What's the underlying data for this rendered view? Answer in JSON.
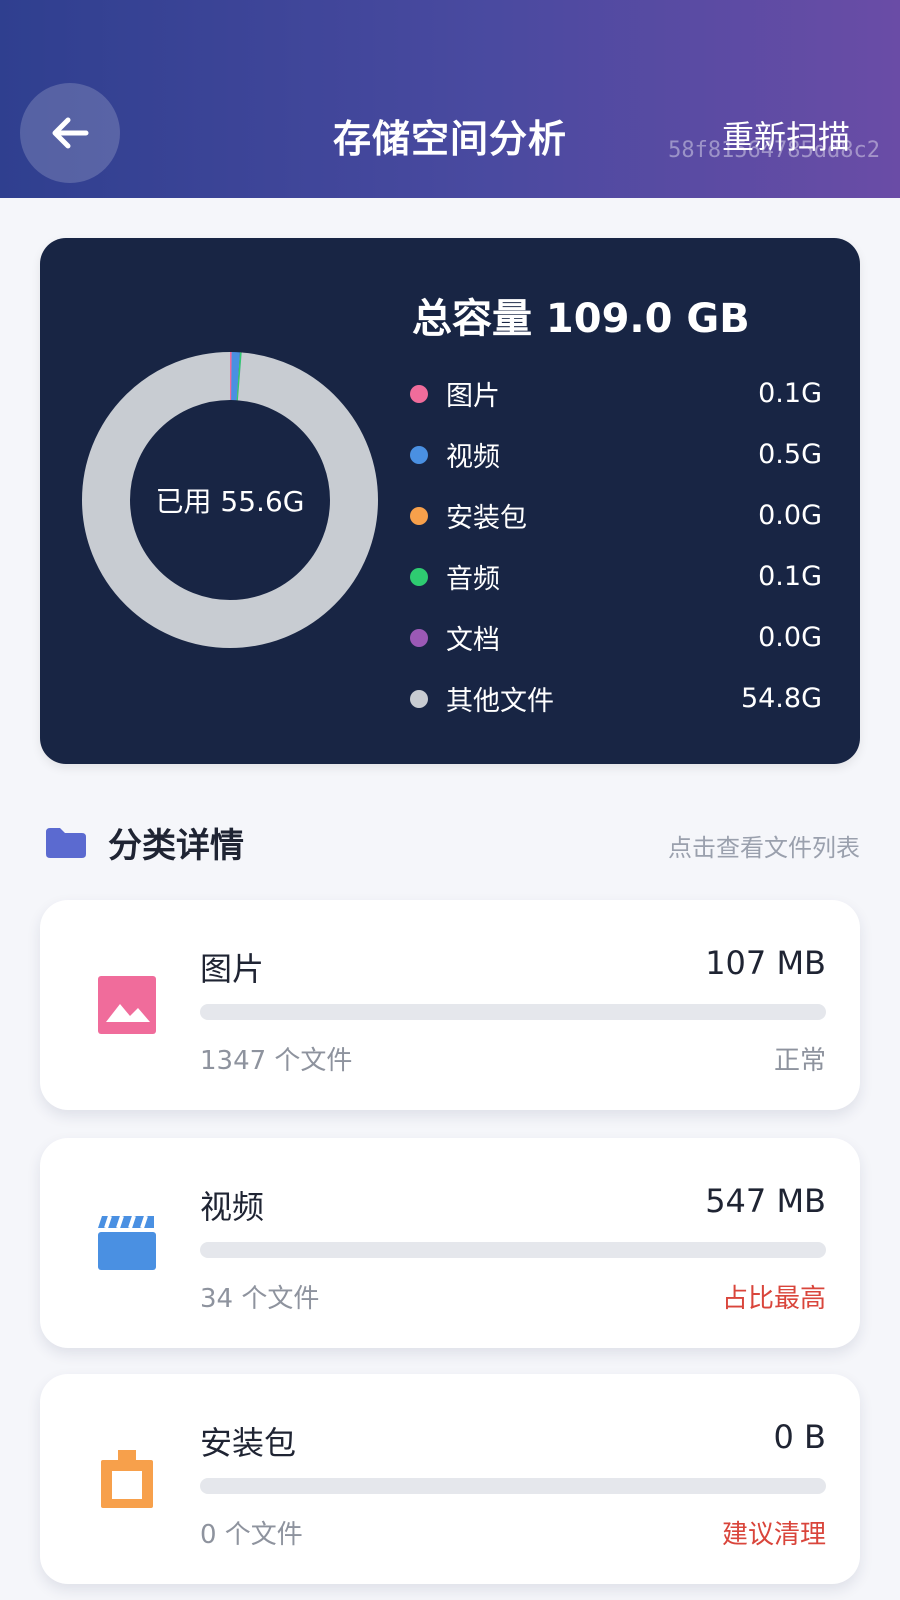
{
  "header": {
    "title": "存储空间分析",
    "rescan_label": "重新扫描",
    "watermark": "58f81564785dd8c2",
    "back_icon": "arrow-left-icon"
  },
  "summary": {
    "total_label": "总容量 109.0 GB",
    "used_label": "已用 55.6G",
    "used_gb": 55.6,
    "legend": [
      {
        "label": "图片",
        "value": "0.1G",
        "gb": 0.1,
        "color": "#f06c9b"
      },
      {
        "label": "视频",
        "value": "0.5G",
        "gb": 0.5,
        "color": "#4a90e2"
      },
      {
        "label": "安装包",
        "value": "0.0G",
        "gb": 0.0,
        "color": "#f7a04b"
      },
      {
        "label": "音频",
        "value": "0.1G",
        "gb": 0.1,
        "color": "#2ecc71"
      },
      {
        "label": "文档",
        "value": "0.0G",
        "gb": 0.0,
        "color": "#9b59b6"
      },
      {
        "label": "其他文件",
        "value": "54.8G",
        "gb": 54.8,
        "color": "#c8ccd2"
      }
    ]
  },
  "section": {
    "title": "分类详情",
    "hint": "点击查看文件列表",
    "icon": "folder-icon",
    "icon_color": "#5b6ad0"
  },
  "categories": [
    {
      "name": "图片",
      "size": "107 MB",
      "count": "1347 个文件",
      "status": "正常",
      "status_color": "#8e939e",
      "icon": "image-icon",
      "color": "#f06c9b",
      "fill": 0.0
    },
    {
      "name": "视频",
      "size": "547 MB",
      "count": "34 个文件",
      "status": "占比最高",
      "status_color": "#d9453b",
      "icon": "video-clapper-icon",
      "color": "#4a90e2",
      "fill": 0.0
    },
    {
      "name": "安装包",
      "size": "0 B",
      "count": "0 个文件",
      "status": "建议清理",
      "status_color": "#d9453b",
      "icon": "package-icon",
      "color": "#f7a04b",
      "fill": 0.0
    }
  ]
}
